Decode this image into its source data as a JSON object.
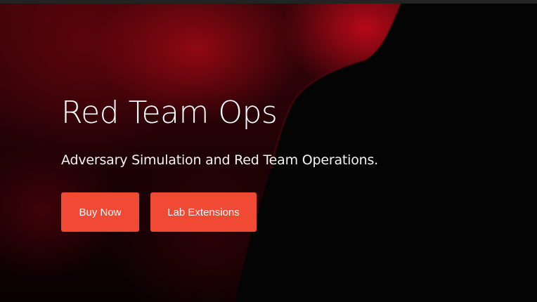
{
  "hero": {
    "title": "Red Team Ops",
    "subtitle": "Adversary Simulation and Red Team Operations.",
    "buttons": {
      "buy_now": "Buy Now",
      "lab_extensions": "Lab Extensions"
    }
  },
  "colors": {
    "button_background": "#f04934",
    "text": "#ffffff",
    "background_dark": "#050505",
    "background_red": "#9c0a14"
  }
}
